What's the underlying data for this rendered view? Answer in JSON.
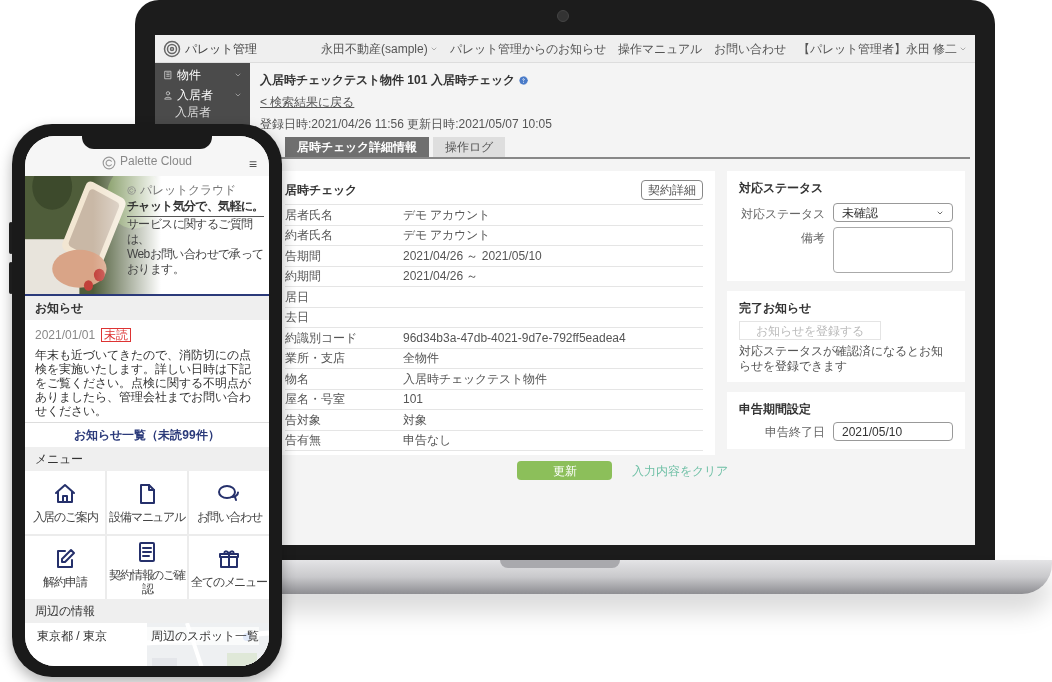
{
  "laptop": {
    "header": {
      "logo_text": "パレット管理",
      "nav": [
        "永田不動産(sample)",
        "パレット管理からのお知らせ",
        "操作マニュアル",
        "お問い合わせ",
        "【パレット管理者】永田 修二"
      ]
    },
    "sidebar": {
      "items": [
        {
          "label": "物件"
        },
        {
          "label": "入居者",
          "children": [
            {
              "label": "入居者"
            }
          ]
        }
      ]
    },
    "page": {
      "title": "入居時チェックテスト物件 101 入居時チェック",
      "back_link": "< 検索結果に戻る",
      "dates": "登録日時:2021/04/26 11:56 更新日時:2021/05/07 10:05",
      "tabs": [
        {
          "label": "居時チェック詳細情報",
          "selected": true
        },
        {
          "label": "操作ログ",
          "selected": false
        }
      ]
    },
    "detail_card": {
      "title": "居時チェック",
      "button": "契約詳細",
      "rows": [
        {
          "label": "居者氏名",
          "value": "デモ アカウント"
        },
        {
          "label": "約者氏名",
          "value": "デモ アカウント"
        },
        {
          "label": "告期間",
          "value": "2021/04/26 ～ 2021/05/10"
        },
        {
          "label": "約期間",
          "value": "2021/04/26 ～"
        },
        {
          "label": "居日"
        },
        {
          "label": "去日"
        },
        {
          "label": "約識別コード",
          "value": "96d34b3a-47db-4021-9d7e-792ff5eadea4"
        },
        {
          "label": "業所・支店",
          "value": "全物件"
        },
        {
          "label": "物名",
          "value": "入居時チェックテスト物件"
        },
        {
          "label": "屋名・号室",
          "value": "101"
        },
        {
          "label": "告対象",
          "value": "対象"
        },
        {
          "label": "告有無",
          "value": "申告なし"
        }
      ]
    },
    "status_card": {
      "title": "対応ステータス",
      "status_label": "対応ステータス",
      "status_value": "未確認",
      "note_label": "備考"
    },
    "notice_card": {
      "title": "完了お知らせ",
      "button": {
        "label": "お知らせを登録する",
        "disabled": true
      },
      "hint": "対応ステータスが確認済になるとお知らせを登録できます"
    },
    "period_card": {
      "title": "申告期間設定",
      "end_label": "申告終了日",
      "end_value": "2021/05/10"
    },
    "actions": {
      "update": "更新",
      "clear": "入力内容をクリア"
    }
  },
  "phone": {
    "header": {
      "logo_text": "Palette Cloud",
      "menu_icon": "≡"
    },
    "hero": {
      "kind": "picture",
      "brand": "パレットクラウド",
      "headline": "チャット気分で、気軽に。",
      "lines": [
        "サービスに関するご質問は、",
        "Webお問い合わせで承っております。"
      ]
    },
    "notices": {
      "title": "お知らせ",
      "date": "2021/01/01",
      "badge": "未読",
      "body": "年末も近づいてきたので、消防切にの点検を実施いたします。詳しい日時は下記をご覧ください。点検に関する不明点がありましたら、管理会社までお問い合わせください。",
      "link": "お知らせ一覧（未読99件）"
    },
    "menu": {
      "title": "メニュー",
      "items": [
        {
          "label": "入居のご案内"
        },
        {
          "label": "設備マニュアル"
        },
        {
          "label": "お問い合わせ"
        },
        {
          "label": "解約申請"
        },
        {
          "label": "契約情報のご確認"
        },
        {
          "label": "全てのメニュー"
        }
      ]
    },
    "nearby": {
      "title": "周辺の情報",
      "location": "東京都 / 東京",
      "spots_link": "周辺のスポット一覧"
    }
  }
}
